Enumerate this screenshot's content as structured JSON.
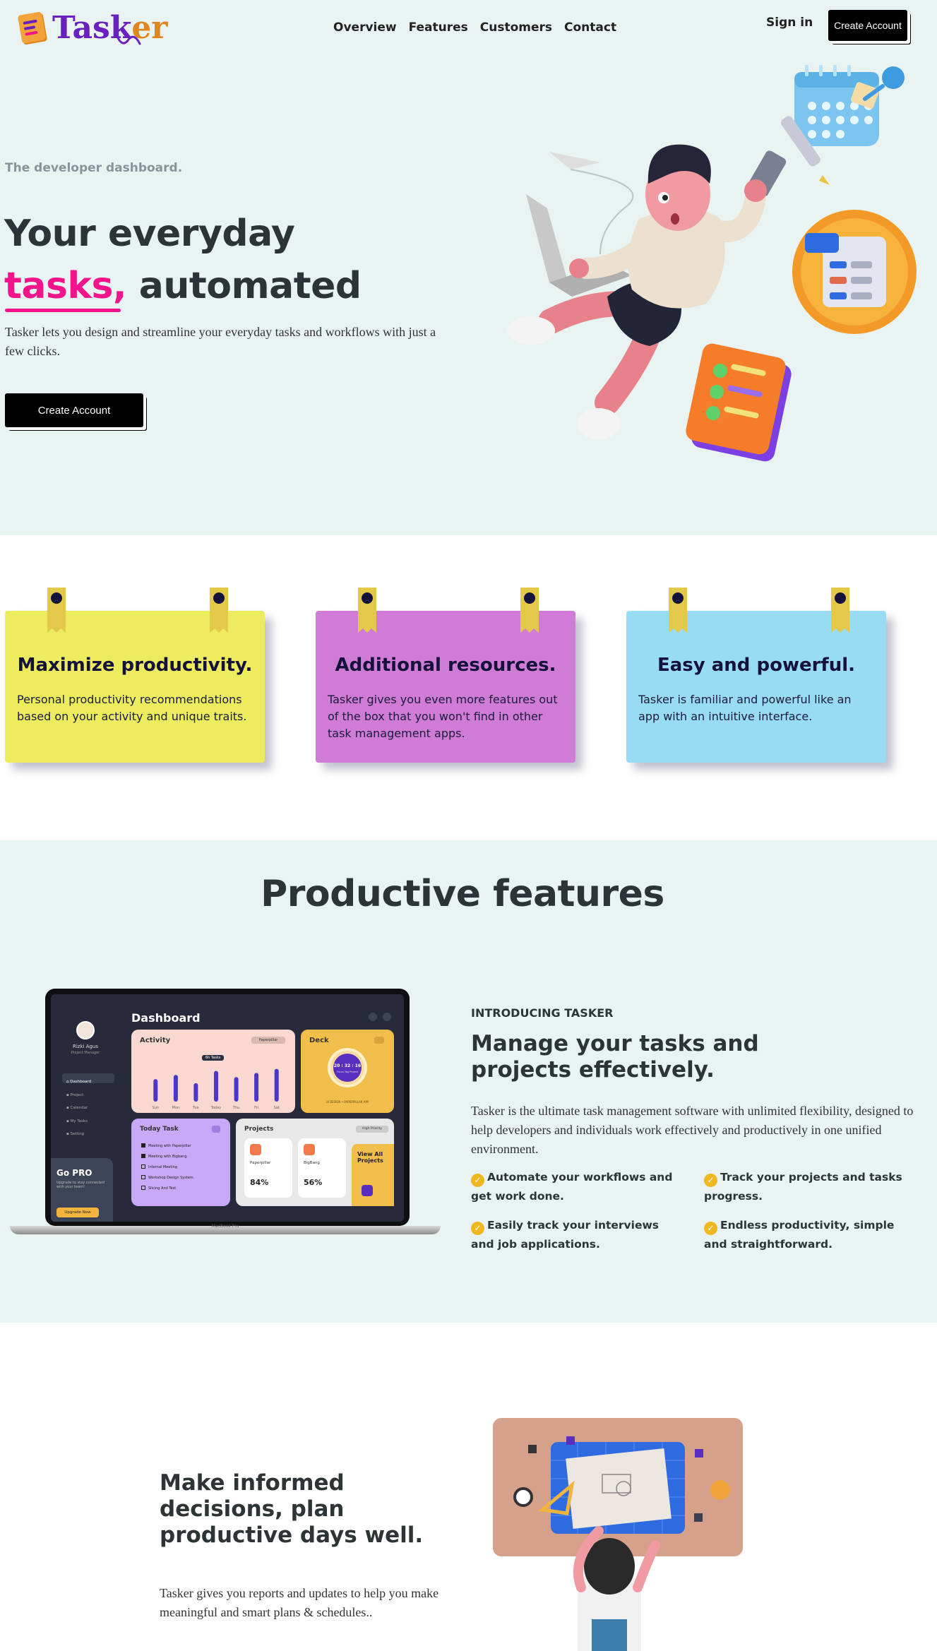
{
  "header": {
    "logo_text_main": "Task",
    "logo_text_accent": "er",
    "nav": [
      "Overview",
      "Features",
      "Customers",
      "Contact"
    ],
    "sign_in": "Sign in",
    "create_account": "Create Account"
  },
  "hero": {
    "kicker": "The developer dashboard.",
    "title_line1": "Your everyday",
    "title_highlight": "tasks,",
    "title_rest": " automated",
    "description": "Tasker lets you design and streamline your everyday tasks and workflows with just a few clicks.",
    "cta": "Create Account"
  },
  "cards": [
    {
      "title": "Maximize productivity.",
      "text": "Personal productivity recommendations based on your activity and unique traits.",
      "color": "#ecec5e"
    },
    {
      "title": "Additional resources.",
      "text": "Tasker gives you even more features out of the box that you won't find in other task management apps.",
      "color": "#d07bd6"
    },
    {
      "title": "Easy and powerful.",
      "text": "Tasker is familiar and powerful like an app with an intuitive interface.",
      "color": "#98dcf4"
    }
  ],
  "features": {
    "heading": "Productive features",
    "intro_kicker": "INTRODUCING TASKER",
    "intro_title": "Manage your tasks and projects effectively.",
    "intro_desc": "Tasker is the ultimate task management software with unlimited flexibility, designed to help developers and individuals work effectively and productively in one unified environment.",
    "bullets": [
      "Automate your workflows and get work done.",
      "Track your projects and tasks progress.",
      "Easily track your interviews and job applications.",
      "Endless productivity, simple and straightforward."
    ]
  },
  "laptop": {
    "dashboard_title": "Dashboard",
    "user_name": "Rizki Agus",
    "user_role": "Project Manager",
    "menu": [
      "Dashboard",
      "Project",
      "Calendar",
      "My Tasks",
      "Setting"
    ],
    "go_pro_title": "Go PRO",
    "go_pro_text": "Upgrade to stay connected with your team!",
    "go_pro_btn": "Upgrade Now",
    "activity_title": "Activity",
    "activity_filter": "Paperpillar",
    "activity_tooltip": "6h Tasks",
    "activity_days": [
      "Sun",
      "Mon",
      "Tue",
      "Today",
      "Thu",
      "Fri",
      "Sat"
    ],
    "activity_values": [
      0.55,
      0.65,
      0.45,
      0.75,
      0.6,
      0.7,
      0.8
    ],
    "deck_title": "Deck",
    "deck_timer": "20 : 32 : 16",
    "deck_sub": "Focus Tag Project",
    "deck_caption": "UI DESIGN • PAPERPILLAR APP",
    "today_title": "Today Task",
    "today_tasks": [
      {
        "label": "Meeting with Paperpillar",
        "done": true
      },
      {
        "label": "Meeting with Bigbang",
        "done": true
      },
      {
        "label": "Internal Meeting",
        "done": false
      },
      {
        "label": "Workshop Design System",
        "done": false
      },
      {
        "label": "Slicing And Test",
        "done": false
      }
    ],
    "projects_title": "Projects",
    "projects_filter": "High Priority",
    "projects": [
      {
        "name": "Paperpillar",
        "progress": "84%"
      },
      {
        "name": "BigBang",
        "progress": "56%"
      }
    ],
    "view_all": "View All Projects",
    "macbook": "MacBook Pro"
  },
  "bottom": {
    "title": "Make informed decisions, plan productive days well.",
    "desc": "Tasker gives you reports and updates to help you make meaningful and smart plans & schedules.."
  }
}
